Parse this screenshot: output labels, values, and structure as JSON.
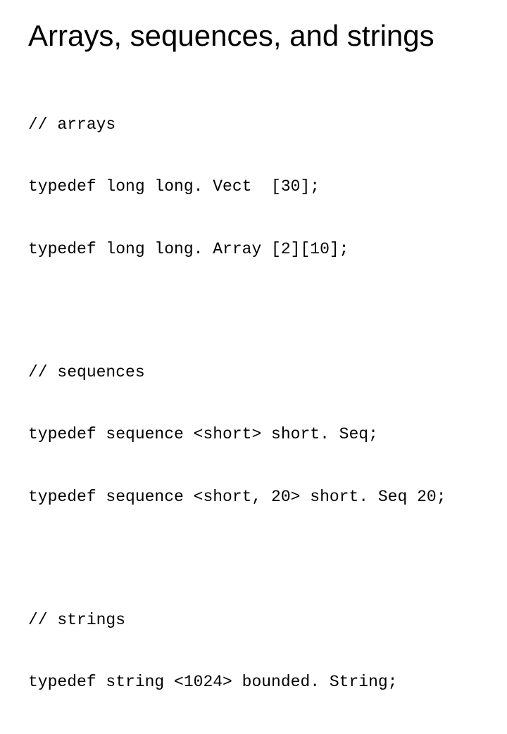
{
  "title": "Arrays, sequences, and strings",
  "blocks": [
    {
      "lines": [
        "// arrays",
        "typedef long long. Vect  [30];",
        "typedef long long. Array [2][10];"
      ]
    },
    {
      "lines": [
        "// sequences",
        "typedef sequence <short> short. Seq;",
        "typedef sequence <short, 20> short. Seq 20;"
      ]
    },
    {
      "lines": [
        "// strings",
        "typedef string <1024> bounded. String;"
      ]
    }
  ]
}
